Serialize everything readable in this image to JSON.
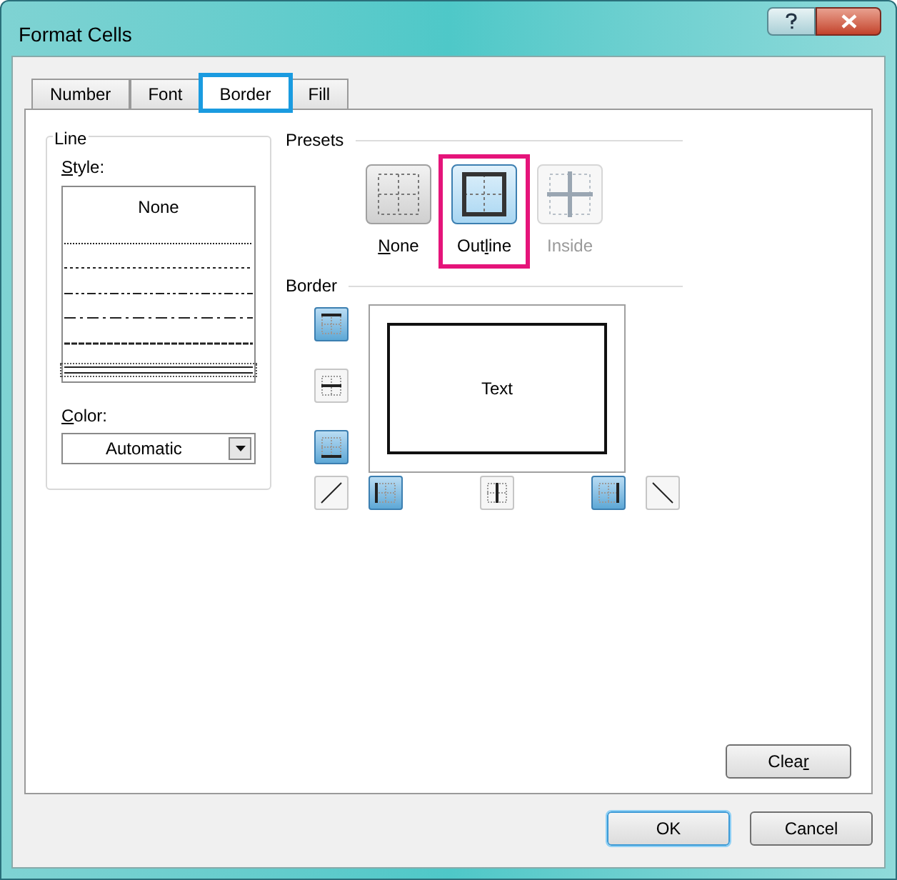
{
  "window": {
    "title": "Format Cells"
  },
  "tabs": [
    {
      "label": "Number",
      "selected": false,
      "highlighted": false
    },
    {
      "label": "Font",
      "selected": false,
      "highlighted": false
    },
    {
      "label": "Border",
      "selected": true,
      "highlighted": true
    },
    {
      "label": "Fill",
      "selected": false,
      "highlighted": false
    }
  ],
  "line": {
    "title": "Line",
    "style_label": {
      "key": "S",
      "post": "tyle:"
    },
    "styles": [
      {
        "kind": "none",
        "label": "None",
        "selected": false
      },
      {
        "kind": "hair",
        "selected": false
      },
      {
        "kind": "dotted",
        "selected": false
      },
      {
        "kind": "dashdotdot",
        "selected": false
      },
      {
        "kind": "dashdot",
        "selected": false
      },
      {
        "kind": "dashed",
        "selected": false
      },
      {
        "kind": "double",
        "selected": true
      }
    ],
    "color_label": {
      "key": "C",
      "post": "olor:"
    },
    "color_value": "Automatic"
  },
  "presets": {
    "title": "Presets",
    "items": [
      {
        "kind": "none",
        "label": {
          "key": "N",
          "post": "one"
        },
        "disabled": false,
        "selected": false,
        "highlighted": false
      },
      {
        "kind": "outline",
        "label": {
          "pre": "Out",
          "key": "l",
          "post": "ine"
        },
        "disabled": false,
        "selected": true,
        "highlighted": true
      },
      {
        "kind": "inside",
        "label": {
          "pre": "Inside"
        },
        "disabled": true,
        "selected": false,
        "highlighted": false
      }
    ]
  },
  "border": {
    "title": "Border",
    "preview_text": "Text",
    "buttons": [
      {
        "kind": "top",
        "on": true
      },
      {
        "kind": "horizontal",
        "on": false
      },
      {
        "kind": "bottom",
        "on": true
      },
      {
        "kind": "diagonal-up",
        "on": false
      },
      {
        "kind": "left",
        "on": true
      },
      {
        "kind": "vertical",
        "on": false
      },
      {
        "kind": "right",
        "on": true
      },
      {
        "kind": "diagonal-down",
        "on": false
      }
    ]
  },
  "clear_button": {
    "label": {
      "pre": "Clea",
      "key": "r"
    }
  },
  "buttons": [
    {
      "label": "OK",
      "default": true
    },
    {
      "label": "Cancel",
      "default": false
    }
  ]
}
